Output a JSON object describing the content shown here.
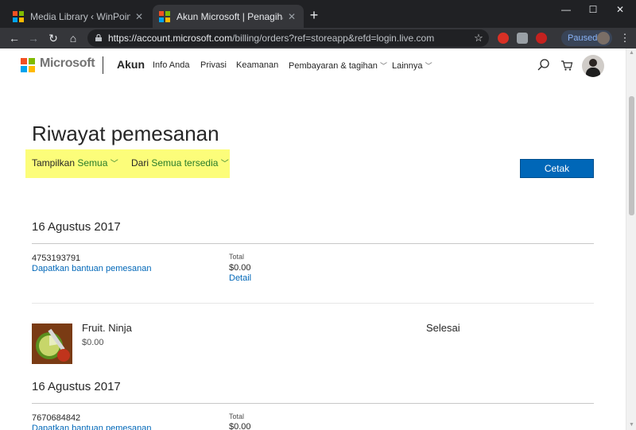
{
  "browser": {
    "tabs": [
      {
        "title": "Media Library ‹ WinPoin — WordPress",
        "active": false
      },
      {
        "title": "Akun Microsoft | Penagihan dan pesanan",
        "active": true
      }
    ],
    "url_host": "https://account.microsoft.com",
    "url_path": "/billing/orders?ref=storeapp&refd=login.live.com",
    "profile_status": "Paused"
  },
  "header": {
    "brand": "Microsoft",
    "section": "Akun",
    "nav": [
      {
        "label": "Info Anda",
        "dropdown": false
      },
      {
        "label": "Privasi",
        "dropdown": false
      },
      {
        "label": "Keamanan",
        "dropdown": false
      },
      {
        "label": "Pembayaran & tagihan",
        "dropdown": true
      },
      {
        "label": "Lainnya",
        "dropdown": true
      }
    ]
  },
  "page": {
    "title": "Riwayat pemesanan",
    "filters": [
      {
        "prefix": "Tampilkan",
        "value": "Semua"
      },
      {
        "prefix": "Dari",
        "value": "Semua tersedia"
      }
    ],
    "print_button": "Cetak",
    "highlight_color": "#fcfd7a",
    "accent_color": "#0067b8"
  },
  "orders": [
    {
      "date": "16 Agustus 2017",
      "order_number": "4753193791",
      "help_link": "Dapatkan bantuan pemesanan",
      "total_label": "Total",
      "total": "$0.00",
      "detail_link": "Detail",
      "item": {
        "name": "Fruit. Ninja",
        "price": "$0.00",
        "status": "Selesai"
      }
    },
    {
      "date": "16 Agustus 2017",
      "order_number": "7670684842",
      "help_link": "Dapatkan bantuan pemesanan",
      "total_label": "Total",
      "total": "$0.00"
    }
  ]
}
